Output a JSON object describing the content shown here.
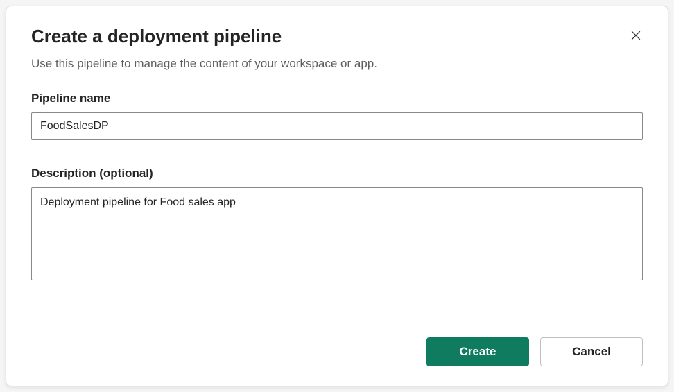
{
  "dialog": {
    "title": "Create a deployment pipeline",
    "subtitle": "Use this pipeline to manage the content of your workspace or app."
  },
  "fields": {
    "pipeline_name": {
      "label": "Pipeline name",
      "value": "FoodSalesDP"
    },
    "description": {
      "label": "Description (optional)",
      "value": "Deployment pipeline for Food sales app"
    }
  },
  "buttons": {
    "create": "Create",
    "cancel": "Cancel"
  },
  "colors": {
    "primary": "#0f7b5f"
  }
}
